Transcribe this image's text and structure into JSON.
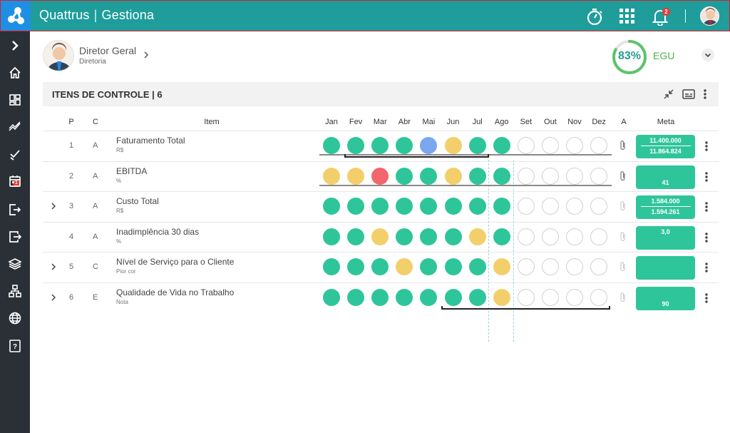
{
  "app": {
    "brand_left": "Quattrus",
    "brand_sep": "|",
    "brand_right": "Gestiona",
    "notifications": "2",
    "accent": "#1e9d9b"
  },
  "sidebar": {
    "badge": "1",
    "items": [
      "expand-icon",
      "home-icon",
      "dashboard-icon",
      "chart-icon",
      "tasks-icon",
      "calendar-icon",
      "logout-icon",
      "export-icon",
      "layers-icon",
      "org-icon",
      "globe-icon",
      "help-icon"
    ]
  },
  "user": {
    "name": "Diretor Geral",
    "role": "Diretoria"
  },
  "score": {
    "value": "83%",
    "label": "EGU",
    "percent": 83
  },
  "section": {
    "title": "ITENS DE CONTROLE | 6"
  },
  "table": {
    "headers": {
      "p": "P",
      "c": "C",
      "item": "Item",
      "a": "A",
      "meta": "Meta"
    },
    "months": [
      "Jan",
      "Fev",
      "Mar",
      "Abr",
      "Mai",
      "Jun",
      "Jul",
      "Ago",
      "Set",
      "Out",
      "Nov",
      "Dez"
    ],
    "rows": [
      {
        "p": "1",
        "c": "A",
        "title": "Faturamento Total",
        "unit": "R$",
        "expand": false,
        "dots": [
          "green",
          "green",
          "green",
          "green",
          "blue",
          "yellow",
          "green",
          "green",
          "empty",
          "empty",
          "empty",
          "empty"
        ],
        "meta_top": "11.400.000",
        "meta_bottom": "11.864.824"
      },
      {
        "p": "2",
        "c": "A",
        "title": "EBITDA",
        "unit": "%",
        "expand": false,
        "dots": [
          "yellow",
          "yellow",
          "red",
          "green",
          "green",
          "yellow",
          "green",
          "green",
          "empty",
          "empty",
          "empty",
          "empty"
        ],
        "meta_top": "",
        "meta_bottom": "41"
      },
      {
        "p": "3",
        "c": "A",
        "title": "Custo Total",
        "unit": "R$",
        "expand": true,
        "dots": [
          "green",
          "green",
          "green",
          "green",
          "green",
          "green",
          "green",
          "green",
          "empty",
          "empty",
          "empty",
          "empty"
        ],
        "meta_top": "1.584.000",
        "meta_bottom": "1.594.261"
      },
      {
        "p": "4",
        "c": "A",
        "title": "Inadimplência 30 dias",
        "unit": "%",
        "expand": false,
        "dots": [
          "green",
          "green",
          "yellow",
          "green",
          "green",
          "green",
          "yellow",
          "green",
          "empty",
          "empty",
          "empty",
          "empty"
        ],
        "meta_top": "3,0",
        "meta_bottom": ""
      },
      {
        "p": "5",
        "c": "C",
        "title": "Nível de Serviço para o Cliente",
        "unit": "Pior cor",
        "expand": true,
        "dots": [
          "green",
          "green",
          "green",
          "yellow",
          "green",
          "green",
          "green",
          "yellow",
          "empty",
          "empty",
          "empty",
          "empty"
        ],
        "meta_top": "",
        "meta_bottom": ""
      },
      {
        "p": "6",
        "c": "E",
        "title": "Qualidade de Vida no Trabalho",
        "unit": "Nota",
        "expand": true,
        "dots": [
          "green",
          "green",
          "green",
          "green",
          "green",
          "green",
          "green",
          "yellow",
          "empty",
          "empty",
          "empty",
          "empty"
        ],
        "meta_top": "",
        "meta_bottom": "90"
      }
    ]
  }
}
